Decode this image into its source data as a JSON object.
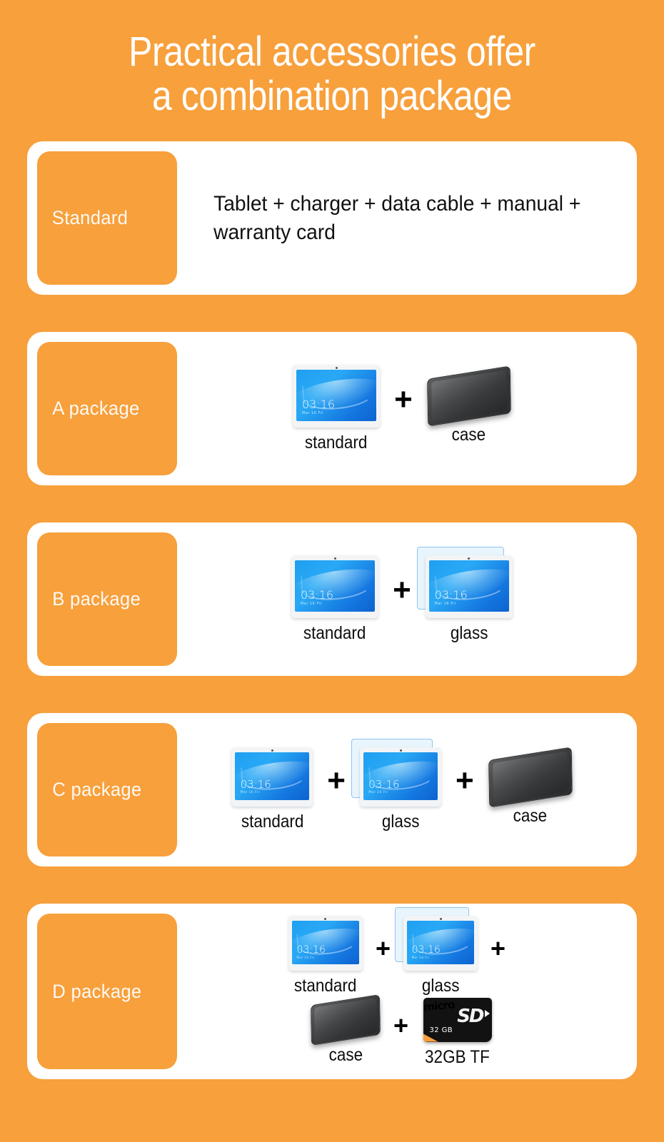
{
  "theme": {
    "background": "#F7A03C",
    "badge": "#F7A03C",
    "card": "#FFFFFF",
    "title_color": "#FFFFFF",
    "text_color": "#111111"
  },
  "title": {
    "line1": "Practical accessories offer",
    "line2": "a combination package"
  },
  "tablet_screen": {
    "time": "03:16",
    "date": "Mar 16 Fri"
  },
  "plus_symbol": "+",
  "rows": [
    {
      "badge": "Standard",
      "type": "text",
      "description": "Tablet + charger + data cable + manual + warranty card"
    },
    {
      "badge": "A package",
      "type": "items",
      "items": [
        {
          "label": "standard",
          "icon": "tablet-icon"
        },
        {
          "label": "case",
          "icon": "case-icon"
        }
      ]
    },
    {
      "badge": "B package",
      "type": "items",
      "items": [
        {
          "label": "standard",
          "icon": "tablet-icon"
        },
        {
          "label": "glass",
          "icon": "screen-protector-icon"
        }
      ]
    },
    {
      "badge": "C package",
      "type": "items",
      "items": [
        {
          "label": "standard",
          "icon": "tablet-icon"
        },
        {
          "label": "glass",
          "icon": "screen-protector-icon"
        },
        {
          "label": "case",
          "icon": "case-icon"
        }
      ]
    },
    {
      "badge": "D package",
      "type": "items-wrapped",
      "line1": [
        {
          "label": "standard",
          "icon": "tablet-icon"
        },
        {
          "label": "glass",
          "icon": "screen-protector-icon"
        }
      ],
      "line2": [
        {
          "label": "case",
          "icon": "case-icon"
        },
        {
          "label": "32GB TF",
          "icon": "microsd-card-icon"
        }
      ]
    }
  ],
  "sd_card": {
    "micro": "micro",
    "sd": "SD",
    "capacity": "32 GB"
  }
}
